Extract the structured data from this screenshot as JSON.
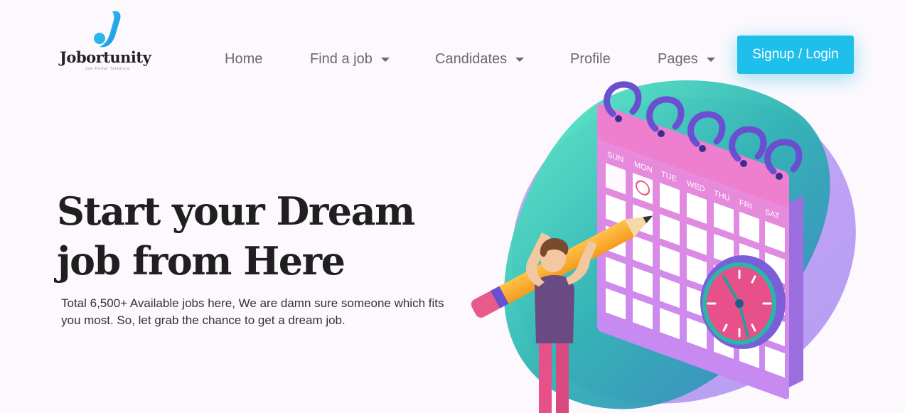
{
  "brand": {
    "name": "Jobortunity",
    "tagline": "Job Portal Template"
  },
  "nav": {
    "items": [
      {
        "label": "Home",
        "dropdown": false
      },
      {
        "label": "Find a job",
        "dropdown": true
      },
      {
        "label": "Candidates",
        "dropdown": true
      },
      {
        "label": "Profile",
        "dropdown": false
      },
      {
        "label": "Pages",
        "dropdown": true
      }
    ],
    "signup_label": "Signup / Login"
  },
  "hero": {
    "title_line1": "Start your Dream",
    "title_line2": "job from Here",
    "subtitle": "Total 6,500+ Available jobs here, We are damn sure someone which fits you most. So, let grab the chance to get a dream job."
  },
  "illustration": {
    "weekdays": [
      "SUN",
      "MON",
      "TUE",
      "WED",
      "THU",
      "FRI",
      "SAT"
    ]
  },
  "colors": {
    "accent": "#1fbfeb",
    "heading": "#1f1f1f",
    "nav_text": "#6a6a6a",
    "background": "#fcf8fd"
  }
}
